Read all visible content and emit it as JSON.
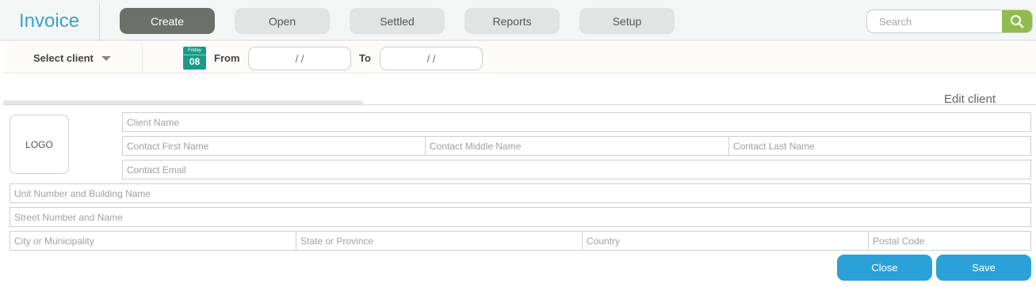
{
  "app": {
    "title": "Invoice"
  },
  "nav": {
    "items": [
      {
        "label": "Create",
        "active": true
      },
      {
        "label": "Open",
        "active": false
      },
      {
        "label": "Settled",
        "active": false
      },
      {
        "label": "Reports",
        "active": false
      },
      {
        "label": "Setup",
        "active": false
      }
    ]
  },
  "search": {
    "placeholder": "Search",
    "icon": "search-icon"
  },
  "filter": {
    "select_client_label": "Select client",
    "calendar": {
      "month": "Friday",
      "day": "08",
      "icon": "calendar-icon"
    },
    "from_label": "From",
    "from_value": "/     /",
    "to_label": "To",
    "to_value": "/     /"
  },
  "panel": {
    "edit_client_label": "Edit client",
    "logo_label": "LOGO"
  },
  "form": {
    "client_name": "Client Name",
    "contact_first": "Contact First Name",
    "contact_middle": "Contact Middle Name",
    "contact_last": "Contact Last Name",
    "contact_email": "Contact Email",
    "unit_building": "Unit Number and Building Name",
    "street": "Street Number and Name",
    "city": "City or Municipality",
    "state": "State or Province",
    "country": "Country",
    "postal": "Postal Code"
  },
  "actions": {
    "close_label": "Close",
    "save_label": "Save"
  },
  "colors": {
    "accent": "#3aa2c8",
    "search_button": "#8fbc4d",
    "active_nav": "#6b7068",
    "action_button": "#2aa1d8",
    "calendar": "#1a9a88"
  }
}
